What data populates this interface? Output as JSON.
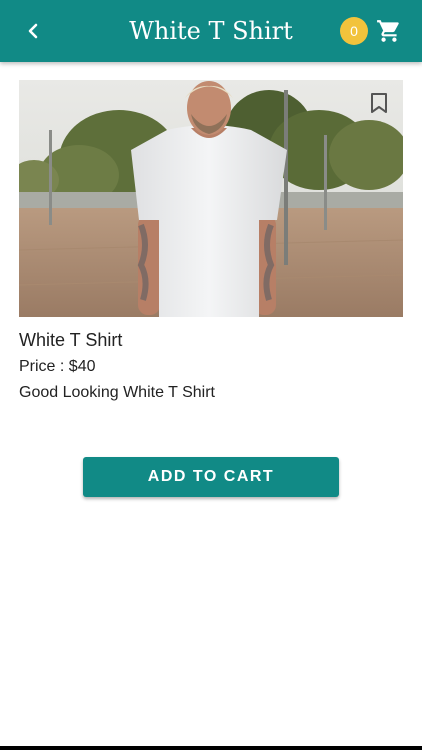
{
  "header": {
    "title": "White T Shirt",
    "cart_count": "0",
    "back_icon": "chevron-left-icon",
    "cart_icon": "shopping-cart-icon"
  },
  "product": {
    "name": "White T Shirt",
    "price": "Price : $40",
    "description": "Good Looking White T Shirt",
    "bookmark_icon": "bookmark-outline-icon"
  },
  "actions": {
    "add_to_cart_label": "ADD TO CART"
  },
  "colors": {
    "primary": "#118a86",
    "badge": "#f2c33c",
    "text": "#222222"
  }
}
